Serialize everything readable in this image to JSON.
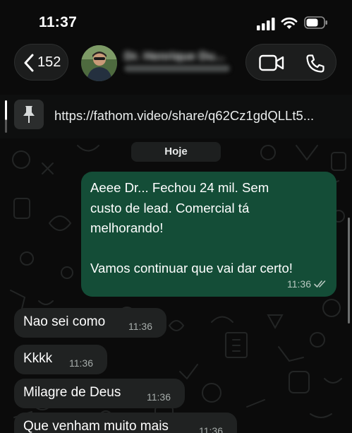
{
  "status_bar": {
    "time": "11:37"
  },
  "header": {
    "back_count": "152",
    "contact_name": "Dr. Henrique Du..."
  },
  "pinned": {
    "text": "https://fathom.video/share/q62Cz1gdQLLt5..."
  },
  "chat": {
    "date_label": "Hoje",
    "outgoing": {
      "text_lines": [
        "Aeee Dr... Fechou 24 mil. Sem",
        "custo de lead. Comercial tá",
        "melhorando!",
        "",
        "Vamos continuar que vai dar certo!"
      ],
      "line1": "Aeee Dr... Fechou 24 mil. Sem",
      "line2": "custo de lead. Comercial tá",
      "line3": "melhorando!",
      "line4": "Vamos continuar que vai dar certo!",
      "time": "11:36",
      "status": "read"
    },
    "incoming": [
      {
        "text": "Nao sei como",
        "time": "11:36"
      },
      {
        "text": "Kkkk",
        "time": "11:36"
      },
      {
        "text": "Milagre de Deus",
        "time": "11:36"
      },
      {
        "text": "Que venham muito mais",
        "time": "11:36"
      }
    ]
  },
  "colors": {
    "outgoing_bubble": "#144d37",
    "incoming_bubble": "#202222",
    "background": "#0b0b0b",
    "read_ticks": "#b8c8c1"
  },
  "icons": [
    "signal-icon",
    "wifi-icon",
    "battery-icon",
    "chevron-left-icon",
    "video-call-icon",
    "phone-icon",
    "pin-icon",
    "double-check-icon"
  ]
}
